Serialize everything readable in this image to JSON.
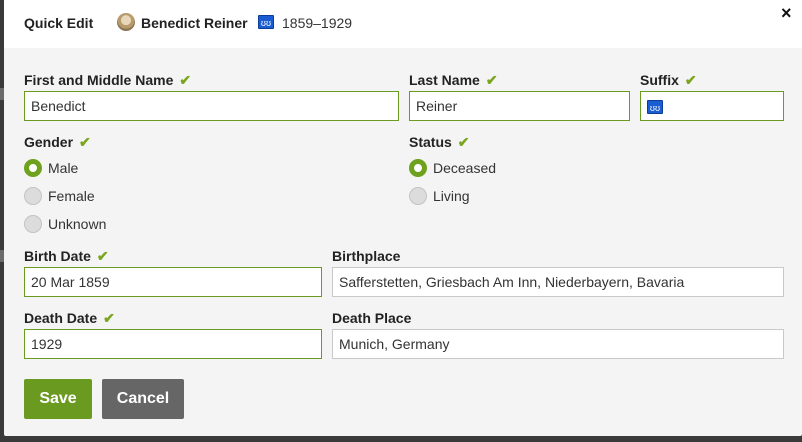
{
  "header": {
    "title": "Quick Edit",
    "person_name": "Benedict Reiner",
    "badge": "ʊʊ",
    "dates": "1859–1929",
    "close": "×"
  },
  "fields": {
    "first_name": {
      "label": "First and Middle Name",
      "value": "Benedict"
    },
    "last_name": {
      "label": "Last Name",
      "value": "Reiner"
    },
    "suffix": {
      "label": "Suffix",
      "value": "ʊʊ"
    },
    "gender": {
      "label": "Gender",
      "options": [
        "Male",
        "Female",
        "Unknown"
      ],
      "selected": "Male"
    },
    "status": {
      "label": "Status",
      "options": [
        "Deceased",
        "Living"
      ],
      "selected": "Deceased"
    },
    "birth_date": {
      "label": "Birth Date",
      "value": "20 Mar 1859"
    },
    "birthplace": {
      "label": "Birthplace",
      "value": "Safferstetten, Griesbach Am Inn, Niederbayern, Bavaria"
    },
    "death_date": {
      "label": "Death Date",
      "value": "1929"
    },
    "death_place": {
      "label": "Death Place",
      "value": "Munich, Germany"
    }
  },
  "check_mark": "✔",
  "buttons": {
    "save": "Save",
    "cancel": "Cancel"
  },
  "colors": {
    "accent": "#6a9a1f",
    "check": "#7aa51e",
    "badge": "#1a5cd1",
    "cancel": "#666666"
  }
}
